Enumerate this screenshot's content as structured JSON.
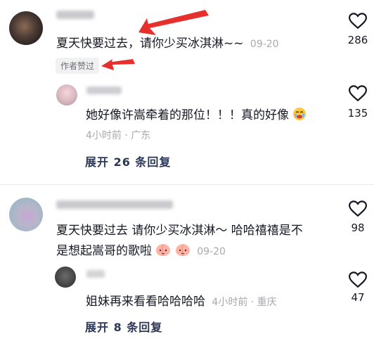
{
  "comments": [
    {
      "text": "夏天快要过去，请你少买冰淇淋~~",
      "time": "09-20",
      "badge": "作者赞过",
      "likes": "286",
      "replies": [
        {
          "text": "她好像许嵩牵着的那位！！！真的好像",
          "time_location": "4小时前 · 广东",
          "likes": "135"
        }
      ],
      "expand_label": "展开 26 条回复"
    },
    {
      "text_line1": "夏天快要过去 请你少买冰淇淋～ 哈哈禧禧是不",
      "text_line2": "是想起嵩哥的歌啦",
      "time": "09-20",
      "likes": "98",
      "replies": [
        {
          "text": "姐妹再来看看哈哈哈哈",
          "time_location": "4小时前 · 重庆",
          "likes": "47"
        }
      ],
      "expand_label": "展开 8 条回复"
    }
  ],
  "colors": {
    "arrow": "#e5302d",
    "expand": "#2b3756",
    "meta": "#a8a9ae"
  }
}
